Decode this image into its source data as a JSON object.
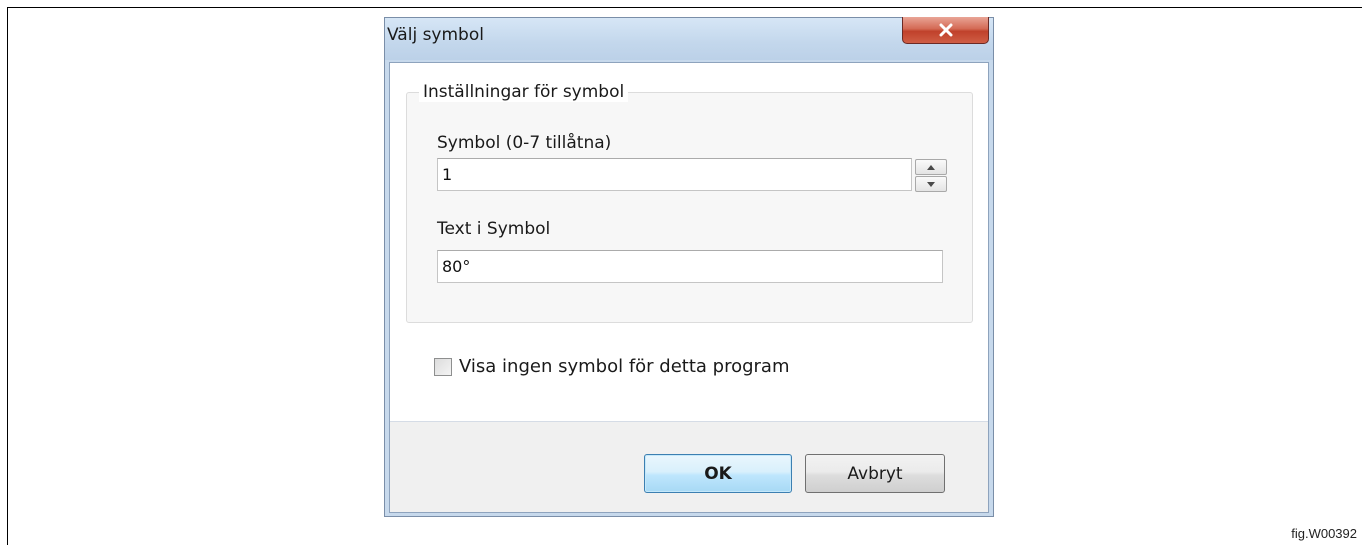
{
  "figure": {
    "label": "fig.W00392"
  },
  "dialog": {
    "title": "Välj symbol",
    "close_icon": "close-x-icon",
    "group": {
      "legend": "Inställningar för symbol",
      "symbol_field": {
        "label": "Symbol (0-7 tillåtna)",
        "value": "1",
        "spin_up_icon": "spin-up-arrow-icon",
        "spin_down_icon": "spin-down-arrow-icon"
      },
      "text_field": {
        "label": "Text i Symbol",
        "value": "80°"
      }
    },
    "checkbox": {
      "label": "Visa ingen symbol för detta program",
      "checked": false
    },
    "buttons": {
      "ok_label": "OK",
      "cancel_label": "Avbryt"
    },
    "colors": {
      "title_bar": "#c3d7ec",
      "close_button": "#c0412b",
      "ok_button_border": "#3c7fb1",
      "footer_background": "#f0f0f0"
    }
  }
}
